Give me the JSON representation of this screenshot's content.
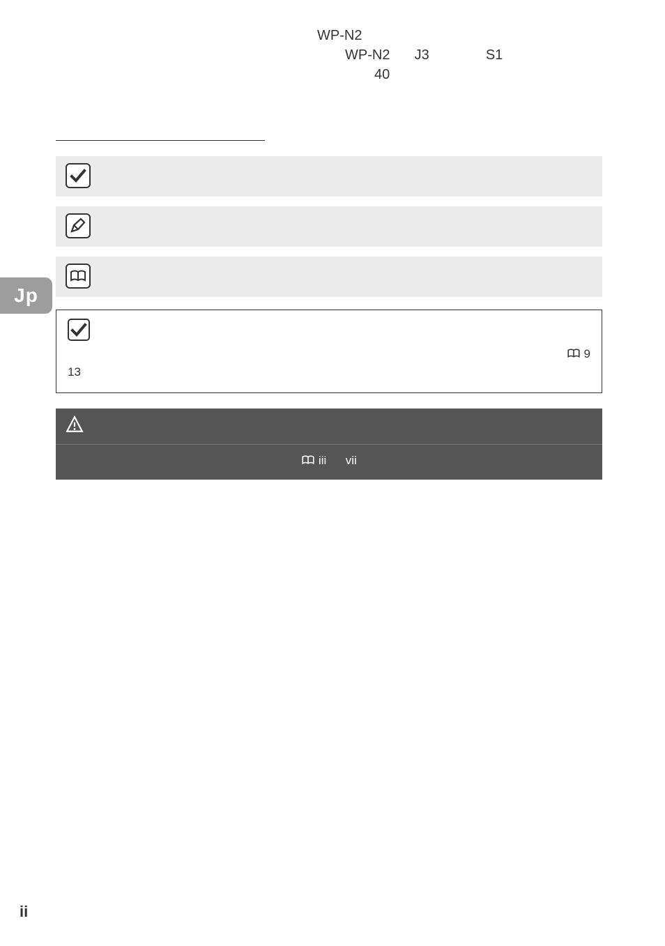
{
  "lang_tab": "Jp",
  "page_number": "ii",
  "intro": {
    "line1_a": "WP-N2",
    "line2_a": "WP-N2",
    "line2_b": "J3",
    "line2_c": "S1",
    "line3_a": "40"
  },
  "section_heading": " ",
  "sub_heading": " ",
  "sub_desc": " ",
  "rows": [
    {
      "title": " ",
      "desc": " "
    },
    {
      "title": " ",
      "desc": " "
    },
    {
      "title": " ",
      "desc": " "
    }
  ],
  "note": {
    "title": " ",
    "body_prefix": " ",
    "ref1": "9",
    "body_mid": "13",
    "body_suffix": " "
  },
  "safety": {
    "title": " ",
    "body_prefix": " ",
    "ref1": "iii",
    "ref_sep": "vii",
    "body_suffix": " "
  }
}
